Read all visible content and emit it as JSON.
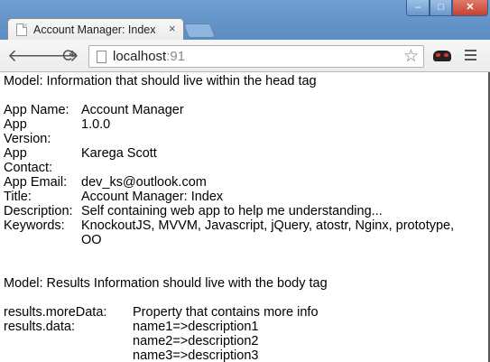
{
  "browser": {
    "tab_title": "Account Manager: Index",
    "tab_close": "×",
    "url_host": "localhost",
    "url_port": ":91",
    "window_controls": {
      "minimize": "‒",
      "maximize": "□",
      "close": "✕"
    },
    "icons": [
      "back-icon",
      "forward-icon",
      "reload-icon",
      "star-icon",
      "extension-icon",
      "menu-icon"
    ]
  },
  "head_section": {
    "heading": "Model: Information that should live within the head tag",
    "rows": [
      {
        "label": [
          "App Name:"
        ],
        "value": [
          "Account Manager"
        ]
      },
      {
        "label": [
          "App",
          "Version:"
        ],
        "value": [
          "1.0.0"
        ]
      },
      {
        "label": [
          "App",
          "Contact:"
        ],
        "value": [
          "Karega Scott"
        ]
      },
      {
        "label": [
          "App Email:"
        ],
        "value": [
          "dev_ks@outlook.com"
        ]
      },
      {
        "label": [
          "Title:"
        ],
        "value": [
          "Account Manager: Index"
        ]
      },
      {
        "label": [
          "Description:"
        ],
        "value": [
          "Self containing web app to help me understanding..."
        ]
      },
      {
        "label": [
          "Keywords:"
        ],
        "value": [
          "KnockoutJS, MVVM, Javascript, jQuery, atostr, Nginx, prototype,",
          "OO"
        ]
      }
    ]
  },
  "body_section": {
    "heading": "Model: Results Information should live with the body tag",
    "rows": [
      {
        "label": [
          "results.moreData:"
        ],
        "value": [
          "Property that contains more info"
        ]
      },
      {
        "label": [
          "results.data:"
        ],
        "value": [
          "name1=>description1",
          "name2=>description2",
          "name3=>description3"
        ]
      }
    ]
  }
}
